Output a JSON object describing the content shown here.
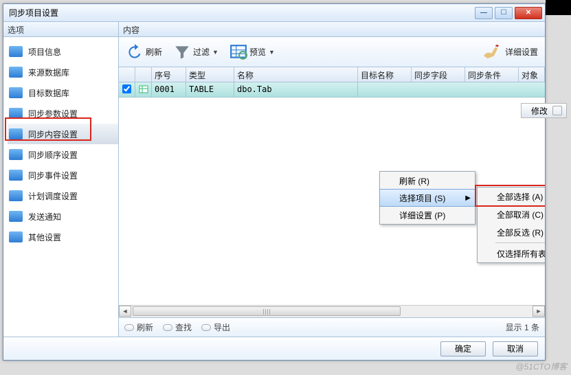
{
  "window": {
    "title": "同步项目设置"
  },
  "panes": {
    "left_title": "选项",
    "right_title": "内容"
  },
  "sidebar": {
    "items": [
      {
        "label": "项目信息"
      },
      {
        "label": "来源数据库"
      },
      {
        "label": "目标数据库"
      },
      {
        "label": "同步参数设置"
      },
      {
        "label": "同步内容设置"
      },
      {
        "label": "同步顺序设置"
      },
      {
        "label": "同步事件设置"
      },
      {
        "label": "计划调度设置"
      },
      {
        "label": "发送通知"
      },
      {
        "label": "其他设置"
      }
    ]
  },
  "toolbar": {
    "refresh": "刷新",
    "filter": "过滤",
    "preview": "预览",
    "advanced": "详细设置"
  },
  "columns": {
    "seq": "序号",
    "type": "类型",
    "name": "名称",
    "target": "目标名称",
    "fields": "同步字段",
    "cond": "同步条件",
    "obj": "对象"
  },
  "rows": [
    {
      "checked": true,
      "seq": "0001",
      "type": "TABLE",
      "name": "dbo.Tab"
    }
  ],
  "ctxmenu1": {
    "refresh": "刷新 (R)",
    "select": "选择项目 (S)",
    "detail": "详细设置 (P)"
  },
  "ctxmenu2": {
    "all": "全部选择 (A)",
    "none": "全部取消 (C)",
    "invert": "全部反选 (R)",
    "tables": "仅选择所有表 (T)"
  },
  "footer": {
    "refresh": "刷新",
    "find": "查找",
    "export": "导出",
    "count": "显示 1 条"
  },
  "dialog": {
    "ok": "确定",
    "cancel": "取消"
  },
  "external": {
    "modify": "修改"
  },
  "watermark": "@51CTO博客"
}
